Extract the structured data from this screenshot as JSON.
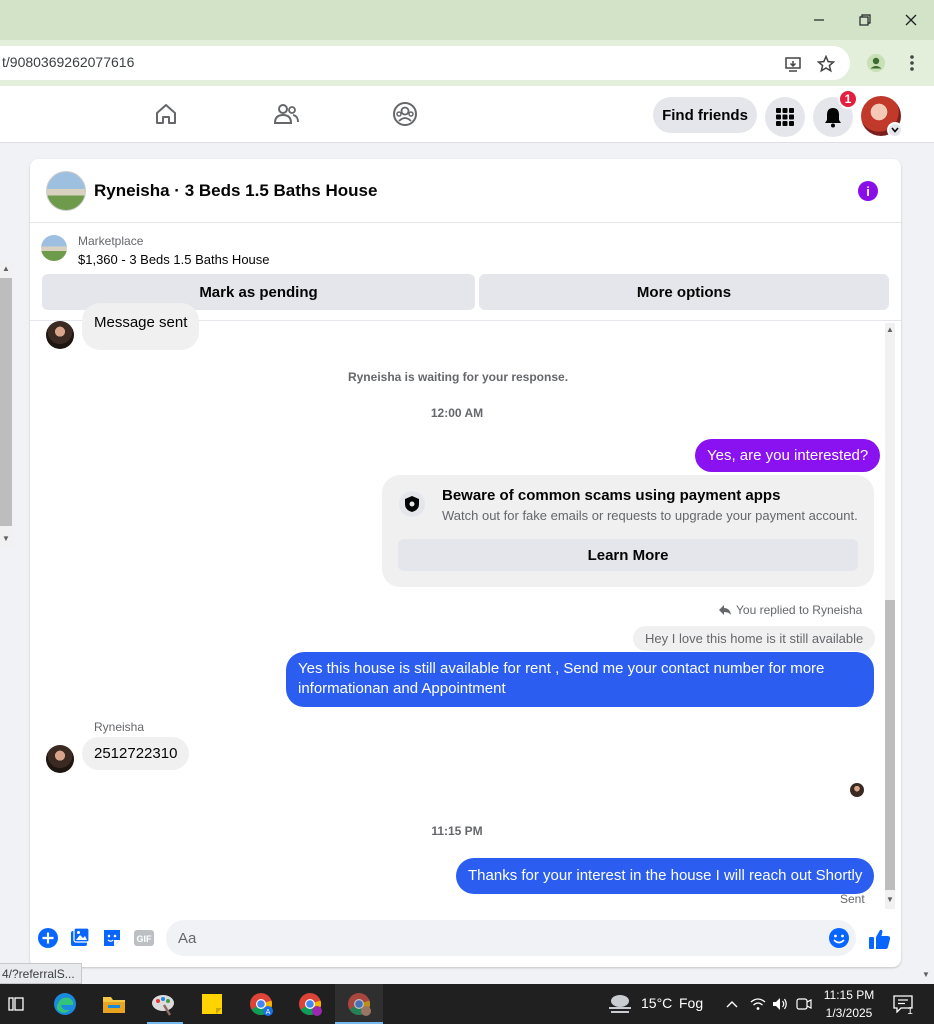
{
  "browser": {
    "url": "t/9080369262077616",
    "status_url": "4/?referralS..."
  },
  "header": {
    "find_friends_label": "Find friends",
    "notification_count": "1"
  },
  "chat": {
    "title": "Ryneisha · 3 Beds 1.5 Baths House",
    "marketplace_label": "Marketplace",
    "listing": "$1,360 - 3 Beds 1.5 Baths House",
    "mark_pending_label": "Mark as pending",
    "more_options_label": "More options",
    "messages": {
      "message_sent": "Message sent",
      "waiting": "Ryneisha is waiting for your response.",
      "time1": "12:00 AM",
      "interested": "Yes, are you interested?",
      "scam_title": "Beware of common scams using payment apps",
      "scam_desc": "Watch out for fake emails or requests to upgrade your payment account.",
      "learn_more": "Learn More",
      "replied_to": "You replied to Ryneisha",
      "quoted": "Hey I love this home is it still available",
      "reply_line1": "Yes this house is still available for rent , Send me your contact number for more",
      "reply_line2": "informationan and Appointment",
      "sender_name": "Ryneisha",
      "phone": "2512722310",
      "time2": "11:15 PM",
      "thanks": "Thanks for your interest in the house I will reach out Shortly",
      "sent_status": "Sent"
    },
    "composer_placeholder": "Aa"
  },
  "taskbar": {
    "weather_temp": "15°C",
    "weather_desc": "Fog",
    "time": "11:15 PM",
    "date": "1/3/2025",
    "notif_count": "1"
  },
  "colors": {
    "accent_blue": "#2b5ef0",
    "accent_purple": "#8a12f0",
    "like_blue": "#0866ff"
  }
}
